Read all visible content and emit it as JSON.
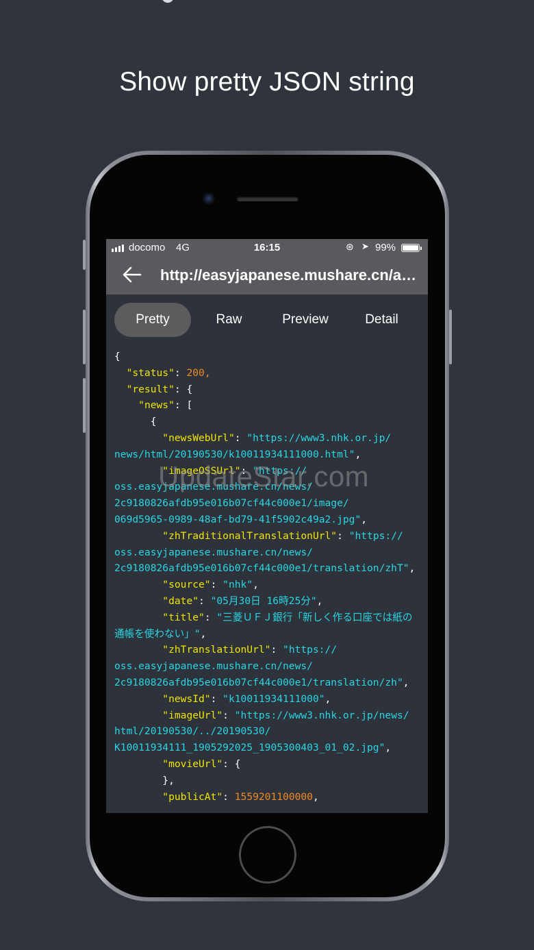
{
  "headline": "Show pretty JSON string",
  "status_bar": {
    "carrier": "docomo",
    "network": "4G",
    "time": "16:15",
    "battery": "99%"
  },
  "nav": {
    "back_icon": "arrow-left-icon",
    "url": "http://easyjapanese.mushare.cn/api..."
  },
  "tabs": [
    {
      "label": "Pretty",
      "active": true
    },
    {
      "label": "Raw",
      "active": false
    },
    {
      "label": "Preview",
      "active": false
    },
    {
      "label": "Detail",
      "active": false
    }
  ],
  "colors": {
    "background": "#2f343d",
    "json_key": "#f2e600",
    "json_string": "#2ad6e4",
    "json_number": "#f08a24",
    "active_tab": "#5c5c5f"
  },
  "json_lines": [
    [
      [
        "p",
        "{"
      ]
    ],
    [
      [
        "p",
        "  "
      ],
      [
        "k",
        "\"status\""
      ],
      [
        "p",
        ": "
      ],
      [
        "n",
        "200"
      ],
      [
        "n",
        ","
      ]
    ],
    [
      [
        "p",
        "  "
      ],
      [
        "k",
        "\"result\""
      ],
      [
        "p",
        ": {"
      ]
    ],
    [
      [
        "p",
        "    "
      ],
      [
        "k",
        "\"news\""
      ],
      [
        "p",
        ": ["
      ]
    ],
    [
      [
        "p",
        "      {"
      ]
    ],
    [
      [
        "p",
        "        "
      ],
      [
        "k",
        "\"newsWebUrl\""
      ],
      [
        "p",
        ": "
      ],
      [
        "s",
        "\"https://www3.nhk.or.jp/"
      ]
    ],
    [
      [
        "s",
        "news/html/20190530/k10011934111000.html\""
      ],
      [
        "p",
        ","
      ]
    ],
    [
      [
        "p",
        "        "
      ],
      [
        "k",
        "\"imageOSSUrl\""
      ],
      [
        "p",
        ": "
      ],
      [
        "s",
        "\"https://"
      ]
    ],
    [
      [
        "s",
        "oss.easyjapanese.mushare.cn/news/"
      ]
    ],
    [
      [
        "s",
        "2c9180826afdb95e016b07cf44c000e1/image/"
      ]
    ],
    [
      [
        "s",
        "069d5965-0989-48af-bd79-41f5902c49a2.jpg\""
      ],
      [
        "p",
        ","
      ]
    ],
    [
      [
        "p",
        "        "
      ],
      [
        "k",
        "\"zhTraditionalTranslationUrl\""
      ],
      [
        "p",
        ": "
      ],
      [
        "s",
        "\"https://"
      ]
    ],
    [
      [
        "s",
        "oss.easyjapanese.mushare.cn/news/"
      ]
    ],
    [
      [
        "s",
        "2c9180826afdb95e016b07cf44c000e1/translation/zhT\""
      ],
      [
        "p",
        ","
      ]
    ],
    [
      [
        "p",
        "        "
      ],
      [
        "k",
        "\"source\""
      ],
      [
        "p",
        ": "
      ],
      [
        "s",
        "\"nhk\""
      ],
      [
        "p",
        ","
      ]
    ],
    [
      [
        "p",
        "        "
      ],
      [
        "k",
        "\"date\""
      ],
      [
        "p",
        ": "
      ],
      [
        "s",
        "\"05月30日 16時25分\""
      ],
      [
        "p",
        ","
      ]
    ],
    [
      [
        "p",
        "        "
      ],
      [
        "k",
        "\"title\""
      ],
      [
        "p",
        ": "
      ],
      [
        "s",
        "\"三菱ＵＦＪ銀行「新しく作る口座では紙の"
      ]
    ],
    [
      [
        "s",
        "通帳を使わない」\""
      ],
      [
        "p",
        ","
      ]
    ],
    [
      [
        "p",
        "        "
      ],
      [
        "k",
        "\"zhTranslationUrl\""
      ],
      [
        "p",
        ": "
      ],
      [
        "s",
        "\"https://"
      ]
    ],
    [
      [
        "s",
        "oss.easyjapanese.mushare.cn/news/"
      ]
    ],
    [
      [
        "s",
        "2c9180826afdb95e016b07cf44c000e1/translation/zh\""
      ],
      [
        "p",
        ","
      ]
    ],
    [
      [
        "p",
        "        "
      ],
      [
        "k",
        "\"newsId\""
      ],
      [
        "p",
        ": "
      ],
      [
        "s",
        "\"k10011934111000\""
      ],
      [
        "p",
        ","
      ]
    ],
    [
      [
        "p",
        "        "
      ],
      [
        "k",
        "\"imageUrl\""
      ],
      [
        "p",
        ": "
      ],
      [
        "s",
        "\"https://www3.nhk.or.jp/news/"
      ]
    ],
    [
      [
        "s",
        "html/20190530/../20190530/"
      ]
    ],
    [
      [
        "s",
        "K10011934111_1905292025_1905300403_01_02.jpg\""
      ],
      [
        "p",
        ","
      ]
    ],
    [
      [
        "p",
        "        "
      ],
      [
        "k",
        "\"movieUrl\""
      ],
      [
        "p",
        ": {"
      ]
    ],
    [
      [
        "p",
        "        },"
      ]
    ],
    [
      [
        "p",
        "        "
      ],
      [
        "k",
        "\"publicAt\""
      ],
      [
        "p",
        ": "
      ],
      [
        "n",
        "1559201100000"
      ],
      [
        "p",
        ","
      ]
    ]
  ],
  "watermark": "UpdateStar.com"
}
